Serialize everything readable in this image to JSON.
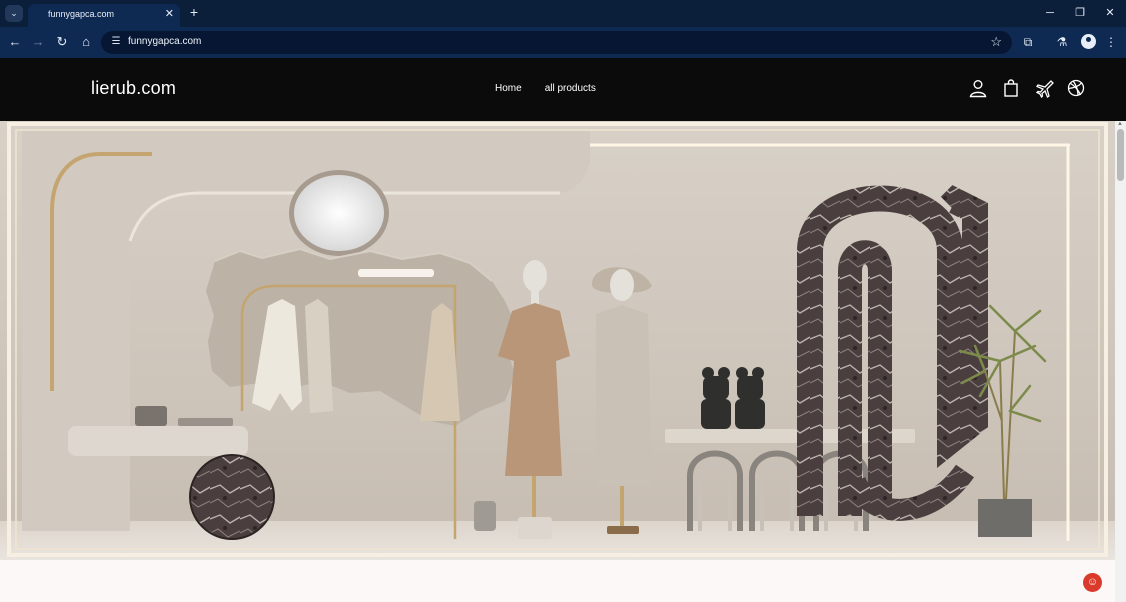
{
  "browser": {
    "tab_title": "funnygapca.com",
    "url": "funnygapca.com",
    "icons": [
      "tab-search-icon",
      "close-icon",
      "plus-icon",
      "minimize-icon",
      "restore-icon",
      "window-close-icon",
      "back-arrow-icon",
      "forward-arrow-icon",
      "reload-icon",
      "home-icon",
      "site-info-icon",
      "star-icon",
      "extensions-icon",
      "labs-icon",
      "profile-icon",
      "kebab-menu-icon"
    ]
  },
  "site": {
    "logo": "lierub.com",
    "nav": {
      "home": "Home",
      "all_products": "all products"
    },
    "header_icons": [
      "user-icon",
      "shopping-bag-icon",
      "plane-icon",
      "dribbble-icon"
    ]
  },
  "hero": {
    "image_description_icon": "boutique-display-image"
  },
  "chat": {
    "icon": "chat-support-icon"
  },
  "colors": {
    "tabbar": "#0b1e3a",
    "toolbar": "#0f2a52",
    "header": "#0b0b0b",
    "chat": "#d93a2b"
  }
}
